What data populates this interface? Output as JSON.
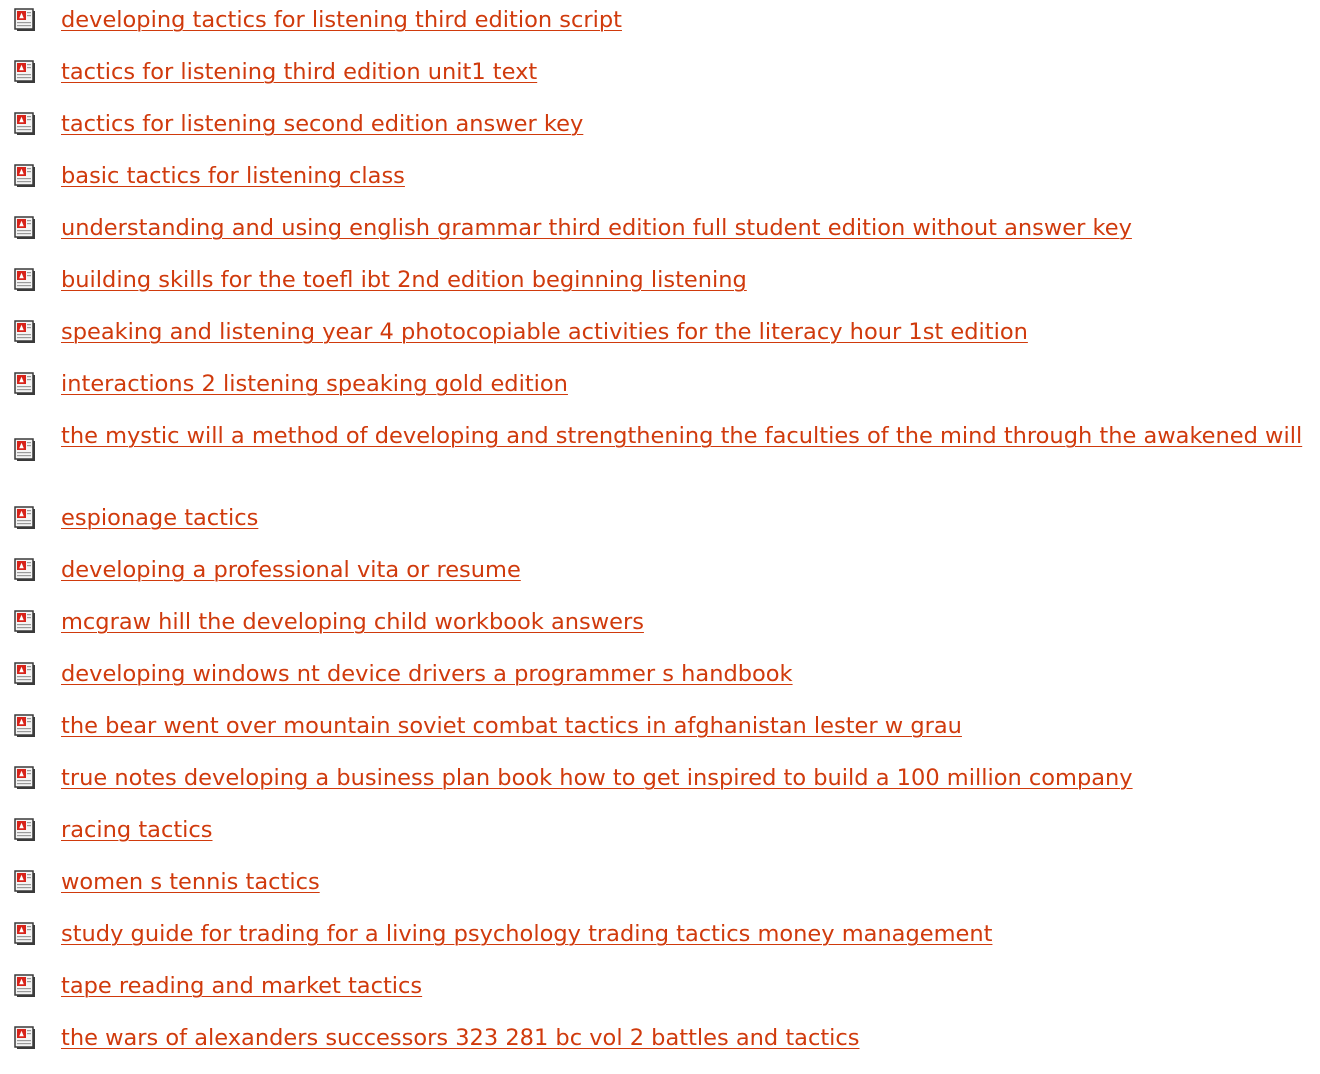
{
  "icon": "pdf-document-icon",
  "colors": {
    "link": "#d03a0c",
    "icon_red": "#d8231a",
    "icon_paper": "#f4f4f4",
    "icon_shadow": "#3a3a3a"
  },
  "links": [
    {
      "label": "developing tactics for listening third edition script"
    },
    {
      "label": "tactics for listening third edition unit1 text"
    },
    {
      "label": "tactics for listening second edition answer key"
    },
    {
      "label": "basic tactics for listening class"
    },
    {
      "label": "understanding and using english grammar third edition full student edition without answer key"
    },
    {
      "label": "building skills for the toefl ibt 2nd edition beginning listening"
    },
    {
      "label": "speaking and listening year 4 photocopiable activities for the literacy hour 1st edition"
    },
    {
      "label": "interactions 2 listening speaking gold edition"
    },
    {
      "label": "the mystic will a method of developing and strengthening the faculties of the mind through the awakened will"
    },
    {
      "label": "espionage tactics"
    },
    {
      "label": "developing a professional vita or resume"
    },
    {
      "label": "mcgraw hill the developing child workbook answers"
    },
    {
      "label": "developing windows nt device drivers a programmer s handbook"
    },
    {
      "label": "the bear went over mountain soviet combat tactics in afghanistan lester w grau"
    },
    {
      "label": "true notes developing a business plan book how to get inspired to build a 100 million company"
    },
    {
      "label": "racing tactics"
    },
    {
      "label": "women s tennis tactics"
    },
    {
      "label": "study guide for trading for a living psychology trading tactics money management"
    },
    {
      "label": "tape reading and market tactics"
    },
    {
      "label": "the wars of alexanders successors 323 281 bc vol 2 battles and tactics"
    }
  ]
}
